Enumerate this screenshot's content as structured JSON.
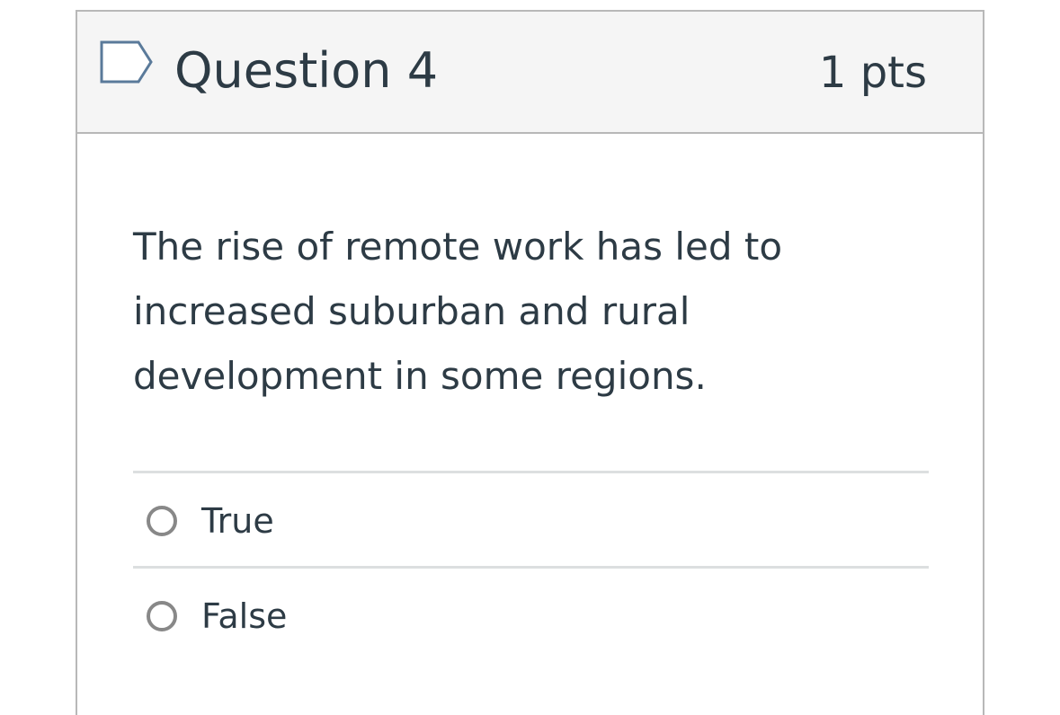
{
  "question": {
    "title": "Question 4",
    "points": "1 pts",
    "flag_icon": "flag-bookmark-icon",
    "text": "The rise of remote work has led to increased suburban and rural development in some regions.",
    "answers": [
      {
        "label": "True",
        "selected": false
      },
      {
        "label": "False",
        "selected": false
      }
    ]
  },
  "colors": {
    "text": "#2d3b45",
    "header_bg": "#f5f5f5",
    "border": "#b8b8b8",
    "flag": "#5a7a9a",
    "radio": "#888888"
  }
}
